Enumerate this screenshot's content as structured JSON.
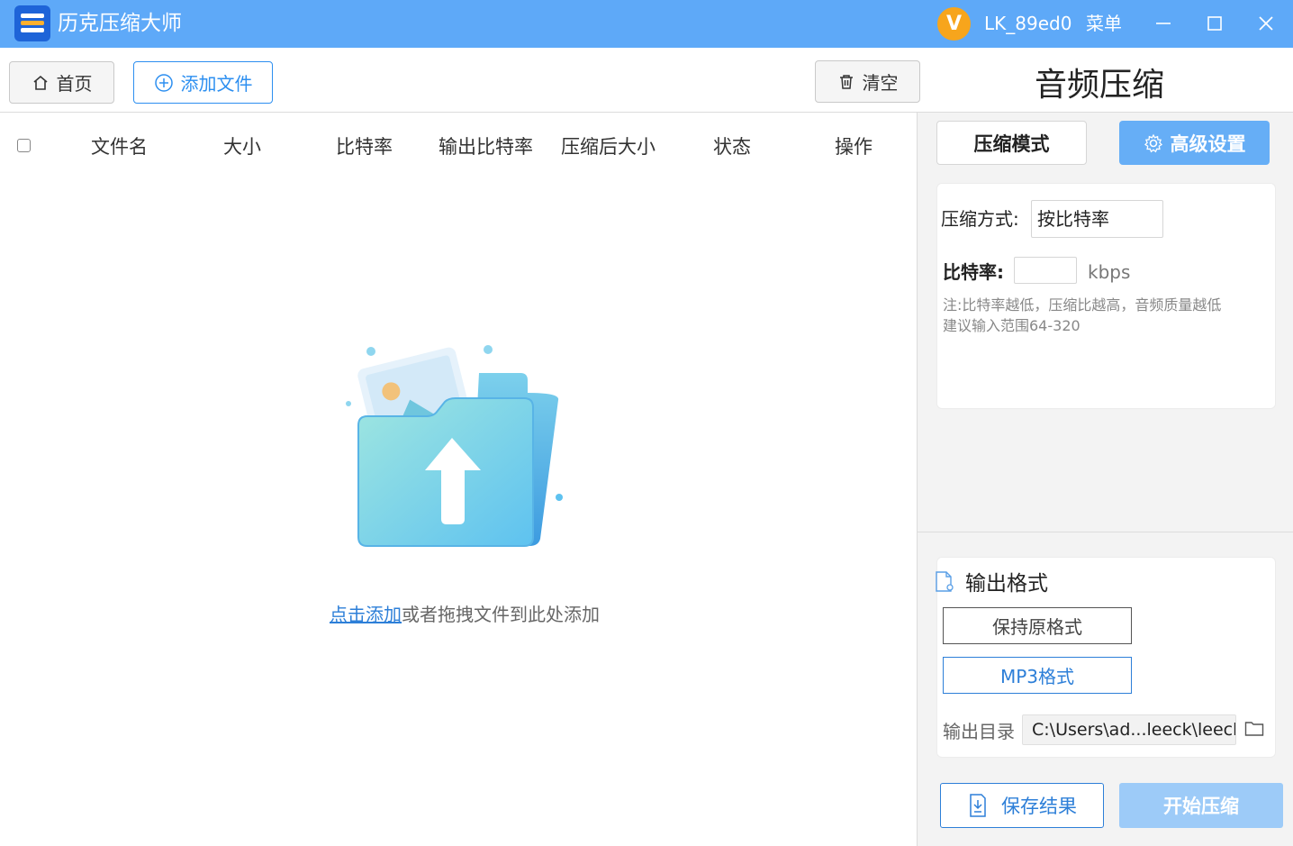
{
  "app": {
    "title": "历克压缩大师",
    "vip_badge": "V",
    "username": "LK_89ed0",
    "menu": "菜单"
  },
  "toolbar": {
    "home": "首页",
    "add_file": "添加文件",
    "clear": "清空"
  },
  "page_title": "音频压缩",
  "table": {
    "headers": [
      "文件名",
      "大小",
      "比特率",
      "输出比特率",
      "压缩后大小",
      "状态",
      "操作"
    ],
    "rows": []
  },
  "drop_zone": {
    "link": "点击添加",
    "text": "或者拖拽文件到此处添加"
  },
  "tabs": {
    "mode": "压缩模式",
    "advanced": "高级设置"
  },
  "settings": {
    "method_label": "压缩方式:",
    "method_value": "按比特率",
    "bitrate_label": "比特率:",
    "bitrate_value": "",
    "bitrate_unit": "kbps",
    "note_line1": "注:比特率越低，压缩比越高，音频质量越低",
    "note_line2": "建议输入范围64-320"
  },
  "output": {
    "title": "输出格式",
    "keep_format": "保持原格式",
    "mp3_format": "MP3格式",
    "dir_label": "输出目录",
    "dir_value": "C:\\Users\\ad...leeck\\leeck"
  },
  "actions": {
    "save_result": "保存结果",
    "start": "开始压缩"
  },
  "colors": {
    "titlebar": "#5ea9f8",
    "accent": "#2d7fd8",
    "vip": "#f7a51c",
    "start_disabled": "#9dcbf8"
  }
}
